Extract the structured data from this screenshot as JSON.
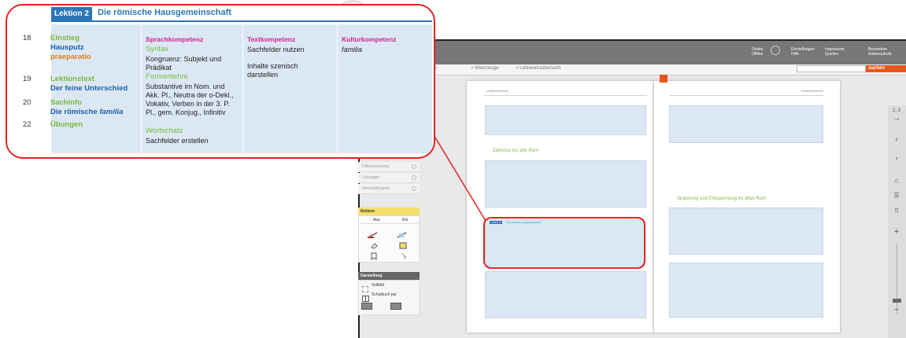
{
  "callout": {
    "lesson_badge": "Lektion 2",
    "lesson_title": "Die römische Hausgemeinschaft",
    "rows": [
      {
        "num": "18",
        "label": "Einstieg",
        "sub1": "Hausputz",
        "sub2": "praeparatio"
      },
      {
        "num": "19",
        "label": "Lektionstext",
        "sub1": "Der feine Unterschied"
      },
      {
        "num": "20",
        "label": "Sachinfo",
        "sub1": "Die römische ",
        "sub1_italic": "familia"
      },
      {
        "num": "22",
        "label": "Übungen"
      }
    ],
    "sprach": {
      "heading": "Sprachkompetenz",
      "syntax": "Syntax",
      "syntax_text": "Kongruenz: Subjekt und Prädikat",
      "formen": "Formenlehre",
      "formen_text": "Substantive im Nom. und Akk. Pl., Neutra der o-Dekl., Vokativ, Verben in der 3. P. Pl., gem. Konjug., Infinitiv",
      "wortschatz": "Wortschatz",
      "wortschatz_text": "Sachfelder erstellen"
    },
    "text": {
      "heading": "Textkompetenz",
      "line1": "Sachfelder nutzen",
      "line2": "Inhalte szenisch darstellen"
    },
    "kultur": {
      "heading": "Kulturkompetenz",
      "line1": "familia"
    }
  },
  "topbar": {
    "online_l1": "Online",
    "online_l2": "Offline",
    "settings_l1": "Einstellungen",
    "settings_l2": "Hilfe",
    "impressum_l1": "Impressum",
    "impressum_l2": "Quellen",
    "bookmarks_l1": "Besondere",
    "bookmarks_l2": "Seitenaufrufe"
  },
  "nav": {
    "item1": "igation",
    "item2": "> Werkzeuge",
    "item3": "> Lehrwerksübersicht",
    "search_button": "suchen"
  },
  "panel": {
    "row1": "Differenzierung",
    "row2": "Lösungen",
    "row3": "Hörmaßbeispiel",
    "notes_title": "Notizen",
    "notes_aus": "Aus",
    "notes_ein": "Ein",
    "view_title": "Darstellung",
    "view_fullscreen": "Vollbild",
    "view_schoolbook": "Schulbuch pur"
  },
  "book": {
    "left_header": "Inhaltsverzeichnis",
    "right_header": "Inhaltsverzeichnis",
    "left_lesson": "Lektion 2",
    "left_lesson_title": "Die römische Hausgemeinschaft",
    "section_left": "Zeitreise ins alte Rom",
    "section_right": "Spannung und Entspannung im alten Rom"
  },
  "toolbar": {
    "page_indicator": "2, 3"
  }
}
